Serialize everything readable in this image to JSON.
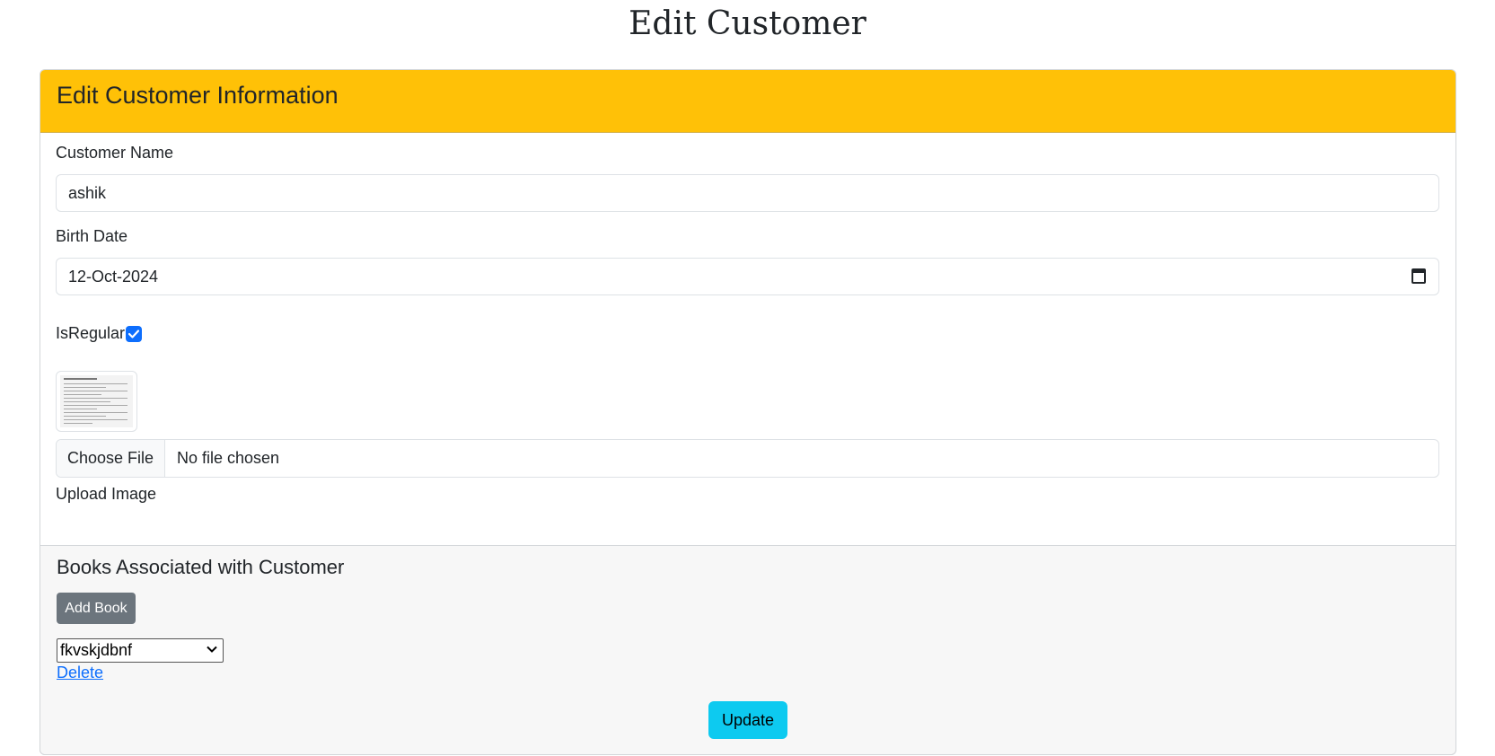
{
  "page": {
    "title": "Edit Customer"
  },
  "card": {
    "header_title": "Edit Customer Information"
  },
  "form": {
    "customer_name": {
      "label": "Customer Name",
      "value": "ashik"
    },
    "birth_date": {
      "label": "Birth Date",
      "value": "12-Oct-2024",
      "icon": "calendar-icon"
    },
    "is_regular": {
      "label": "IsRegular",
      "checked": true
    },
    "image": {
      "choose_label": "Choose File",
      "status": "No file chosen",
      "label": "Upload Image"
    }
  },
  "books": {
    "title": "Books Associated with Customer",
    "add_label": "Add Book",
    "selected_book": "fkvskjdbnf",
    "delete_label": "Delete"
  },
  "actions": {
    "update_label": "Update"
  },
  "colors": {
    "header_bg": "#ffc107",
    "primary": "#0d6efd",
    "secondary": "#6c757d",
    "info": "#0dcaf0"
  }
}
